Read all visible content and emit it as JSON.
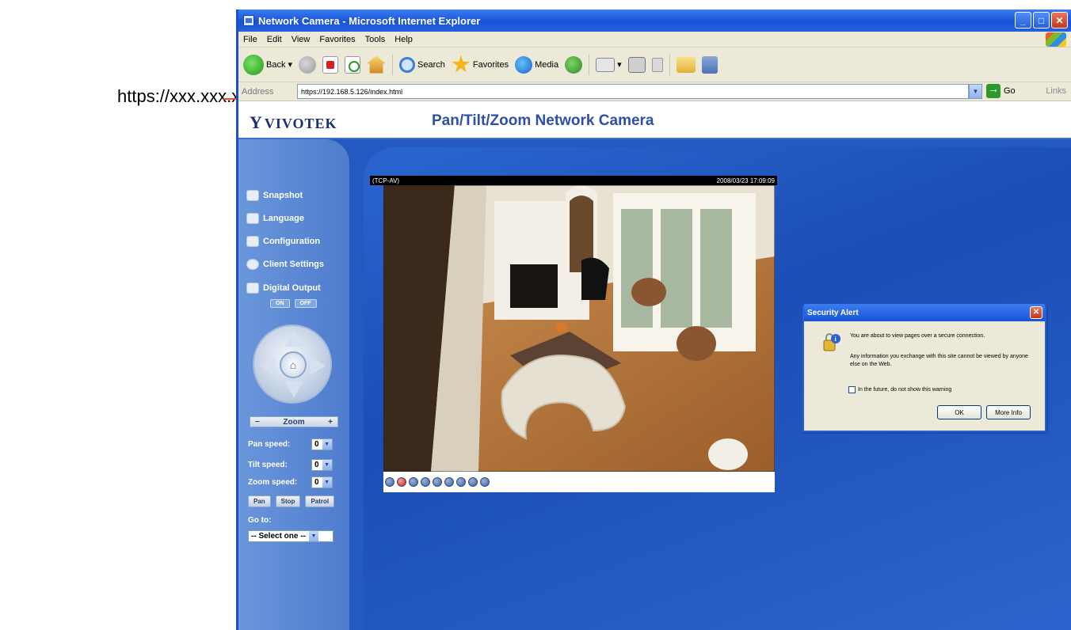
{
  "annotation": {
    "url_text": "https://xxx.xxx.x.xxx"
  },
  "window": {
    "title": "Network Camera - Microsoft Internet Explorer",
    "menu": [
      "File",
      "Edit",
      "View",
      "Favorites",
      "Tools",
      "Help"
    ],
    "toolbar": {
      "back_label": "Back",
      "search_label": "Search",
      "favorites_label": "Favorites",
      "media_label": "Media"
    },
    "address": {
      "label": "Address",
      "url": "https://192.168.5.126/index.html",
      "go_label": "Go",
      "links_label": "Links"
    }
  },
  "page": {
    "logo": "VIVOTEK",
    "title": "Pan/Tilt/Zoom Network Camera",
    "sidebar": {
      "snapshot": "Snapshot",
      "language": "Language",
      "configuration": "Configuration",
      "client_settings": "Client Settings",
      "digital_output": "Digital Output",
      "on": "ON",
      "off": "OFF",
      "zoom_label": "Zoom",
      "zoom_minus": "−",
      "zoom_plus": "+",
      "pan_speed_label": "Pan speed:",
      "pan_speed_value": "0",
      "tilt_speed_label": "Tilt speed:",
      "tilt_speed_value": "0",
      "zoom_speed_label": "Zoom speed:",
      "zoom_speed_value": "0",
      "pan_btn": "Pan",
      "stop_btn": "Stop",
      "patrol_btn": "Patrol",
      "goto_label": "Go to:",
      "goto_value": "-- Select one --"
    },
    "video": {
      "protocol": "(TCP-AV)",
      "timestamp": "2008/03/23 17:09:09"
    }
  },
  "dialog": {
    "title": "Security Alert",
    "message1": "You are about to view pages over a secure connection.",
    "message2": "Any information you exchange with this site cannot be viewed by anyone else on the Web.",
    "checkbox_label": "In the future, do not show this warning",
    "ok_label": "OK",
    "more_info_label": "More Info"
  }
}
